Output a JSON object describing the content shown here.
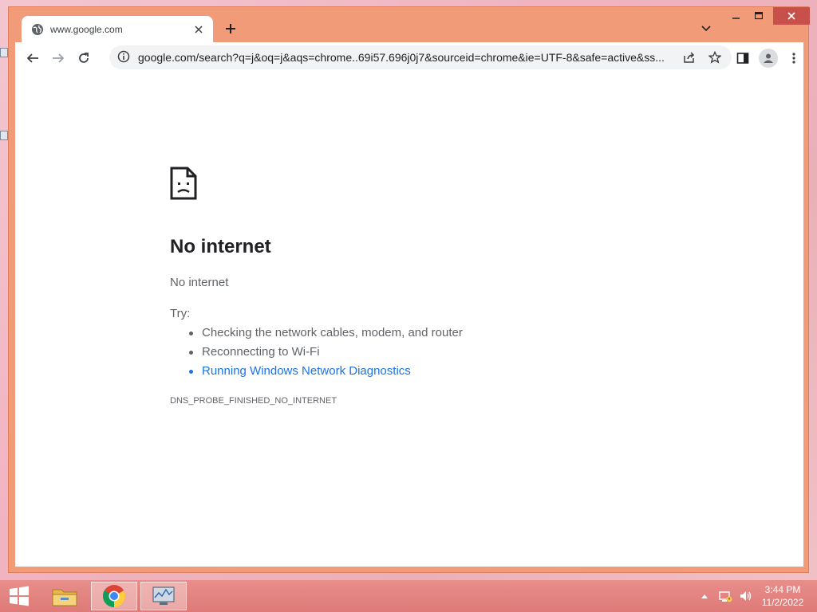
{
  "browser": {
    "tab": {
      "title": "www.google.com"
    },
    "url": "google.com/search?q=j&oq=j&aqs=chrome..69i57.696j0j7&sourceid=chrome&ie=UTF-8&safe=active&ss..."
  },
  "error_page": {
    "title": "No internet",
    "subtitle": "No internet",
    "try_label": "Try:",
    "suggestions": [
      "Checking the network cables, modem, and router",
      "Reconnecting to Wi-Fi",
      "Running Windows Network Diagnostics"
    ],
    "error_code": "DNS_PROBE_FINISHED_NO_INTERNET"
  },
  "taskbar": {
    "items": [
      "windows-start",
      "file-explorer",
      "google-chrome",
      "performance-monitor"
    ],
    "time": "3:44 PM",
    "date": "11/2/2022"
  },
  "colors": {
    "window_frame": "#f29b78",
    "close_button": "#c7514a",
    "link": "#1a73e8",
    "taskbar": "#de7a78"
  }
}
